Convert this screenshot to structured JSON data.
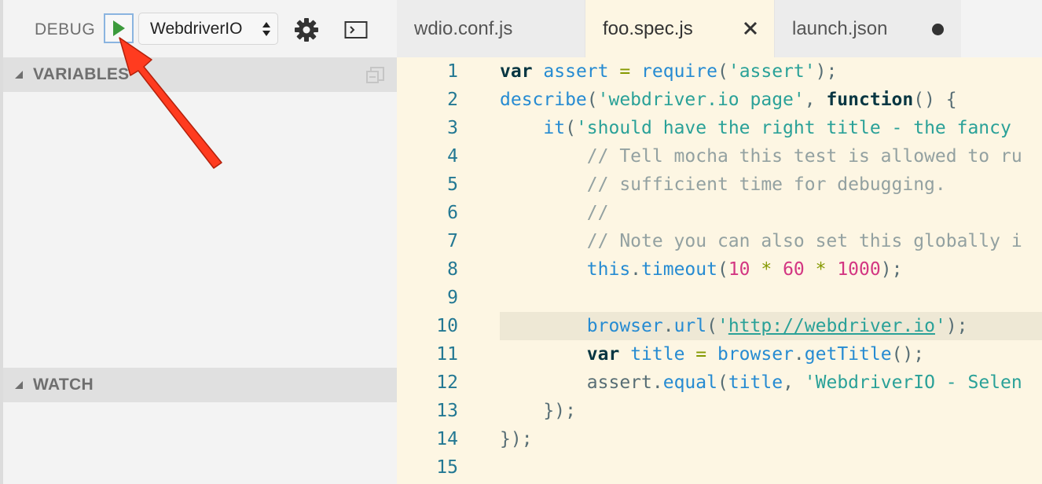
{
  "toolbar": {
    "debug_label": "DEBUG",
    "config_selected": "WebdriverIO",
    "start_icon": "play-icon",
    "settings_icon": "gear-icon",
    "console_icon": "debug-console-icon"
  },
  "sections": {
    "variables": "VARIABLES",
    "watch": "WATCH"
  },
  "tabs": [
    {
      "label": "wdio.conf.js",
      "active": false
    },
    {
      "label": "foo.spec.js",
      "active": true,
      "close_icon": "close-icon"
    },
    {
      "label": "launch.json",
      "active": false,
      "dirty": true
    }
  ],
  "editor": {
    "line_numbers": [
      "1",
      "2",
      "3",
      "4",
      "5",
      "6",
      "7",
      "8",
      "9",
      "10",
      "11",
      "12",
      "13",
      "14",
      "15"
    ],
    "current_line": "10",
    "lines": [
      [
        {
          "t": "var",
          "c": "kw"
        },
        {
          "t": " ",
          "c": "punc"
        },
        {
          "t": "assert",
          "c": "var"
        },
        {
          "t": " = ",
          "c": "op"
        },
        {
          "t": "require",
          "c": "fn"
        },
        {
          "t": "(",
          "c": "punc"
        },
        {
          "t": "'assert'",
          "c": "str"
        },
        {
          "t": ");",
          "c": "punc"
        }
      ],
      [
        {
          "t": "describe",
          "c": "fn"
        },
        {
          "t": "(",
          "c": "punc"
        },
        {
          "t": "'webdriver.io page'",
          "c": "str"
        },
        {
          "t": ", ",
          "c": "punc"
        },
        {
          "t": "function",
          "c": "kw"
        },
        {
          "t": "() {",
          "c": "punc"
        }
      ],
      [
        {
          "t": "    ",
          "c": "punc"
        },
        {
          "t": "it",
          "c": "fn"
        },
        {
          "t": "(",
          "c": "punc"
        },
        {
          "t": "'should have the right title - the fancy",
          "c": "str"
        }
      ],
      [
        {
          "t": "        // Tell mocha this test is allowed to ru",
          "c": "cmt"
        }
      ],
      [
        {
          "t": "        // sufficient time for debugging.",
          "c": "cmt"
        }
      ],
      [
        {
          "t": "        //",
          "c": "cmt"
        }
      ],
      [
        {
          "t": "        // Note you can also set this globally i",
          "c": "cmt"
        }
      ],
      [
        {
          "t": "        ",
          "c": "punc"
        },
        {
          "t": "this",
          "c": "var"
        },
        {
          "t": ".",
          "c": "punc"
        },
        {
          "t": "timeout",
          "c": "fn"
        },
        {
          "t": "(",
          "c": "punc"
        },
        {
          "t": "10",
          "c": "num"
        },
        {
          "t": " * ",
          "c": "op"
        },
        {
          "t": "60",
          "c": "num"
        },
        {
          "t": " * ",
          "c": "op"
        },
        {
          "t": "1000",
          "c": "num"
        },
        {
          "t": ");",
          "c": "punc"
        }
      ],
      [
        {
          "t": "",
          "c": "punc"
        }
      ],
      [
        {
          "t": "        ",
          "c": "punc"
        },
        {
          "t": "browser",
          "c": "var"
        },
        {
          "t": ".",
          "c": "punc"
        },
        {
          "t": "url",
          "c": "fn"
        },
        {
          "t": "(",
          "c": "punc"
        },
        {
          "t": "'",
          "c": "str"
        },
        {
          "t": "http://webdriver.io",
          "c": "url"
        },
        {
          "t": "'",
          "c": "str"
        },
        {
          "t": ");",
          "c": "punc"
        }
      ],
      [
        {
          "t": "        ",
          "c": "punc"
        },
        {
          "t": "var",
          "c": "kw"
        },
        {
          "t": " ",
          "c": "punc"
        },
        {
          "t": "title",
          "c": "var"
        },
        {
          "t": " = ",
          "c": "op"
        },
        {
          "t": "browser",
          "c": "var"
        },
        {
          "t": ".",
          "c": "punc"
        },
        {
          "t": "getTitle",
          "c": "fn"
        },
        {
          "t": "();",
          "c": "punc"
        }
      ],
      [
        {
          "t": "        ",
          "c": "punc"
        },
        {
          "t": "assert",
          "c": "punc"
        },
        {
          "t": ".",
          "c": "punc"
        },
        {
          "t": "equal",
          "c": "fn"
        },
        {
          "t": "(",
          "c": "punc"
        },
        {
          "t": "title",
          "c": "var"
        },
        {
          "t": ", ",
          "c": "punc"
        },
        {
          "t": "'WebdriverIO - Selen",
          "c": "str"
        }
      ],
      [
        {
          "t": "    });",
          "c": "punc"
        }
      ],
      [
        {
          "t": "});",
          "c": "punc"
        }
      ],
      [
        {
          "t": "",
          "c": "punc"
        }
      ]
    ]
  },
  "annotation": {
    "arrow_color": "#ff3b1f",
    "arrow_target": "start-button"
  },
  "colors": {
    "sidebar_bg": "#f3f3f3",
    "editor_bg": "#fdf6e3",
    "play_green": "#3c9a3c"
  }
}
